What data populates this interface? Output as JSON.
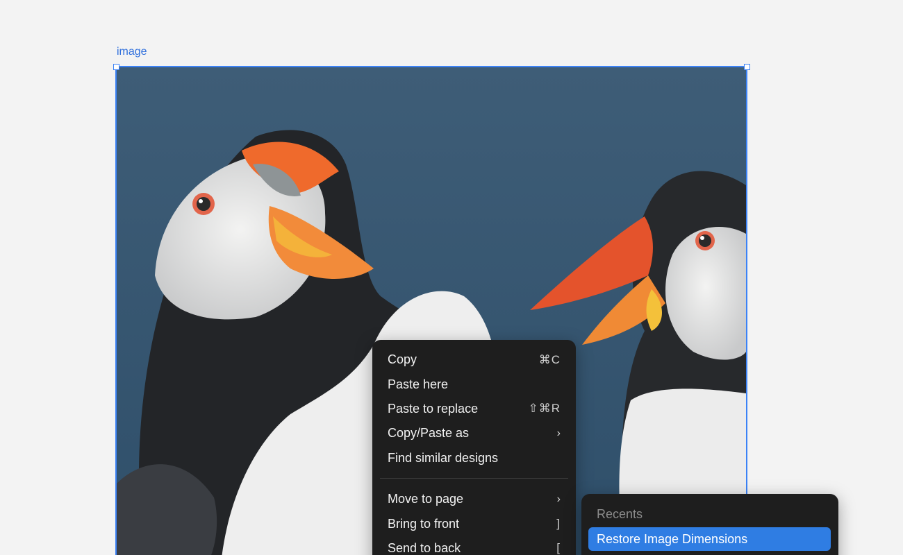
{
  "canvas": {
    "frame_label": "image"
  },
  "context_menu": {
    "groups": [
      [
        {
          "label": "Copy",
          "shortcut": "⌘C"
        },
        {
          "label": "Paste here",
          "shortcut": ""
        },
        {
          "label": "Paste to replace",
          "shortcut": "⇧⌘R"
        },
        {
          "label": "Copy/Paste as",
          "shortcut": "›"
        },
        {
          "label": "Find similar designs",
          "shortcut": ""
        }
      ],
      [
        {
          "label": "Move to page",
          "shortcut": "›"
        },
        {
          "label": "Bring to front",
          "shortcut": "]"
        },
        {
          "label": "Send to back",
          "shortcut": "["
        }
      ]
    ]
  },
  "recents": {
    "heading": "Recents",
    "items": [
      {
        "label": "Restore Image Dimensions"
      }
    ]
  },
  "colors": {
    "accent": "#2f7de3",
    "selection": "#3b82f6",
    "menu_bg": "#1e1e1e"
  }
}
